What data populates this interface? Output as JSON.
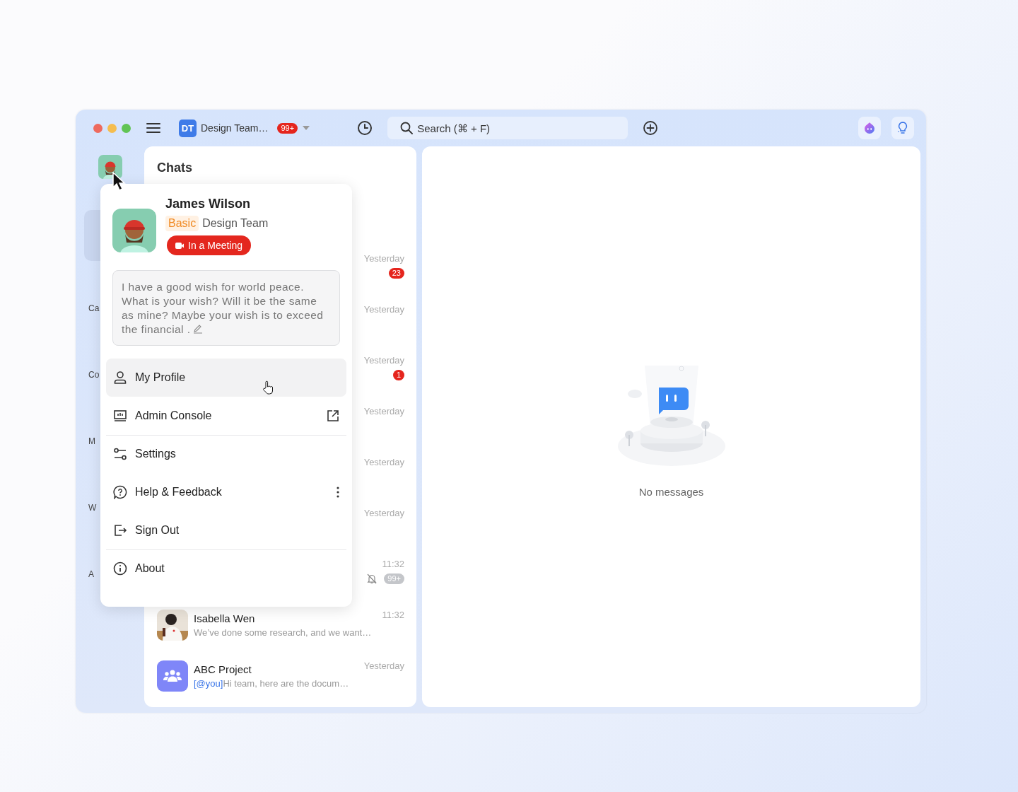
{
  "topbar": {
    "team": {
      "initials": "DT",
      "name": "Design Team…",
      "badge": "99+"
    },
    "search": {
      "placeholder": "Search (⌘ + F)"
    }
  },
  "sidebar": {
    "items": [
      {
        "selected": true
      },
      {
        "label": "Ca",
        "selected": false
      },
      {
        "label": "Co",
        "selected": false
      },
      {
        "label": "M",
        "selected": false
      },
      {
        "label": "W",
        "selected": false
      },
      {
        "label": "A",
        "selected": false
      }
    ]
  },
  "chats": {
    "title": "Chats",
    "rows": [
      {
        "time": "Yesterday",
        "badge": "23",
        "muted": false
      },
      {
        "time": "Yesterday"
      },
      {
        "time": "Yesterday",
        "badge": "1",
        "muted": false
      },
      {
        "time": "Yesterday"
      },
      {
        "time": "Yesterday"
      },
      {
        "time": "Yesterday"
      },
      {
        "time": "11:32",
        "badge": "99+",
        "muted": true
      },
      {
        "kind": "person",
        "name": "Isabella Wen",
        "preview": "We’ve done some research, and we want…",
        "time": "11:32"
      },
      {
        "kind": "group",
        "name": "ABC Project",
        "mention": "[@you]",
        "preview": "Hi team, here are the docum…",
        "time": "Yesterday"
      }
    ]
  },
  "profile_menu": {
    "name": "James Wilson",
    "plan": "Basic",
    "team": "Design Team",
    "status": "In a Meeting",
    "signature": "I have a good wish for world peace. What is your wish? Will it be the same as mine? Maybe your wish is to exceed the financial .",
    "items": [
      {
        "kind": "profile",
        "label": "My Profile",
        "selected": true,
        "divider_before": false
      },
      {
        "kind": "admin",
        "label": "Admin Console",
        "selected": false,
        "divider_before": false,
        "external": true
      },
      {
        "kind": "settings",
        "label": "Settings",
        "selected": false,
        "divider_before": true
      },
      {
        "kind": "help",
        "label": "Help & Feedback",
        "selected": false,
        "divider_before": false,
        "more": true
      },
      {
        "kind": "signout",
        "label": "Sign Out",
        "selected": false,
        "divider_before": false
      },
      {
        "kind": "about",
        "label": "About",
        "selected": false,
        "divider_before": true
      }
    ]
  },
  "empty": {
    "text": "No messages"
  }
}
